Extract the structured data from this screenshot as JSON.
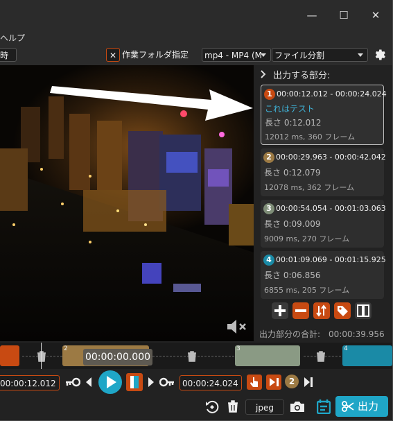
{
  "menubar": {
    "help": "ヘルプ"
  },
  "toolbar": {
    "left_fragment": "時",
    "close_symbol": "✕",
    "working_folder_label": "作業フォルダ指定",
    "format_select": "mp4 - MP4 (M",
    "mode_select": "ファイル分割"
  },
  "panel": {
    "header": "出力する部分:",
    "segments": [
      {
        "num": "1",
        "time": "00:00:12.012 - 00:00:24.024",
        "name": "これはテスト",
        "length": "長さ 0:12.012",
        "ms": "12012 ms, 360 フレーム",
        "color": "#c84a12"
      },
      {
        "num": "2",
        "time": "00:00:29.963 - 00:00:42.042",
        "name": "",
        "length": "長さ 0:12.079",
        "ms": "12078 ms, 362 フレーム",
        "color": "#9c7a44"
      },
      {
        "num": "3",
        "time": "00:00:54.054 - 00:01:03.063",
        "name": "",
        "length": "長さ 0:09.009",
        "ms": "9009 ms, 270 フレーム",
        "color": "#7e8d77"
      },
      {
        "num": "4",
        "time": "00:01:09.069 - 00:01:15.925",
        "name": "",
        "length": "長さ 0:06.856",
        "ms": "6855 ms, 205 フレーム",
        "color": "#1a8aa6"
      }
    ],
    "total": "出力部分の合計:　00:00:39.956"
  },
  "timeline": {
    "current_time": "00:00:00.000",
    "seg2_label": "2",
    "seg3_label": "3",
    "seg4_label": "4"
  },
  "controls": {
    "start_time": "00:00:12.012",
    "end_time": "00:00:24.024",
    "segment_number": "2"
  },
  "bottom": {
    "snapshot_format": "jpeg",
    "export_label": "出力"
  },
  "colors": {
    "accent": "#1fa6c7",
    "brand_orange": "#c84a12"
  }
}
